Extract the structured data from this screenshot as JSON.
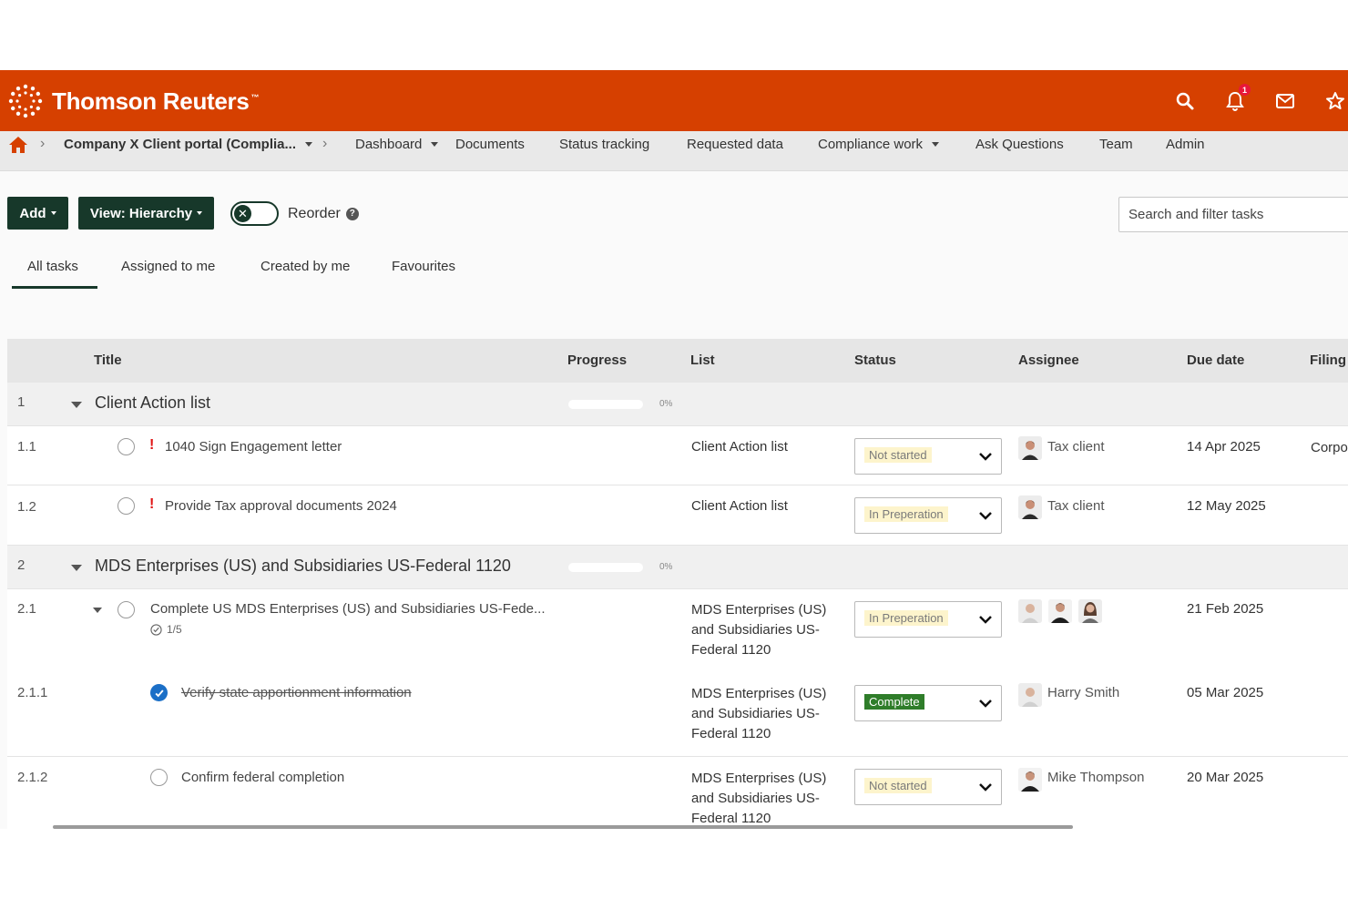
{
  "header": {
    "brand": "Thomson Reuters",
    "trademark": "™",
    "notification_count": "1",
    "brand_color": "#d64000"
  },
  "nav": {
    "portal": "Company X Client portal (Complia...",
    "items": [
      "Dashboard",
      "Documents",
      "Status tracking",
      "Requested data",
      "Compliance work",
      "Ask Questions",
      "Team",
      "Admin"
    ]
  },
  "toolbar": {
    "add_label": "Add",
    "view_label": "View: Hierarchy",
    "reorder_label": "Reorder",
    "search_placeholder": "Search and filter tasks"
  },
  "tabs": [
    "All tasks",
    "Assigned to me",
    "Created by me",
    "Favourites"
  ],
  "table": {
    "columns": [
      "Title",
      "Progress",
      "List",
      "Status",
      "Assignee",
      "Due date",
      "Filing"
    ],
    "groups": [
      {
        "num": "1",
        "title": "Client Action list",
        "progress": "0%"
      },
      {
        "num": "2",
        "title": "MDS Enterprises (US) and Subsidiaries US-Federal 1120",
        "progress": "0%"
      }
    ],
    "tasks": [
      {
        "num": "1.1",
        "title": "1040 Sign Engagement letter",
        "list": "Client Action list",
        "status": "Not started",
        "assignee": "Tax client",
        "due": "14 Apr 2025",
        "filing": "Corpo"
      },
      {
        "num": "1.2",
        "title": "Provide Tax approval documents 2024",
        "list": "Client Action list",
        "status": "In Preperation",
        "assignee": "Tax client",
        "due": "12 May 2025"
      },
      {
        "num": "2.1",
        "title": "Complete US MDS Enterprises (US) and Subsidiaries US-Fede...",
        "subtasks": "1/5",
        "list": "MDS Enterprises (US) and Subsidiaries US-Federal 1120",
        "status": "In Preperation",
        "due": "21 Feb 2025"
      },
      {
        "num": "2.1.1",
        "title": "Verify state apportionment information",
        "list": "MDS Enterprises (US) and Subsidiaries US-Federal 1120",
        "status": "Complete",
        "assignee": "Harry Smith",
        "due": "05 Mar 2025"
      },
      {
        "num": "2.1.2",
        "title": "Confirm federal completion",
        "list": "MDS Enterprises (US) and Subsidiaries US-Federal 1120",
        "status": "Not started",
        "assignee": "Mike Thompson",
        "due": "20 Mar 2025"
      }
    ]
  }
}
